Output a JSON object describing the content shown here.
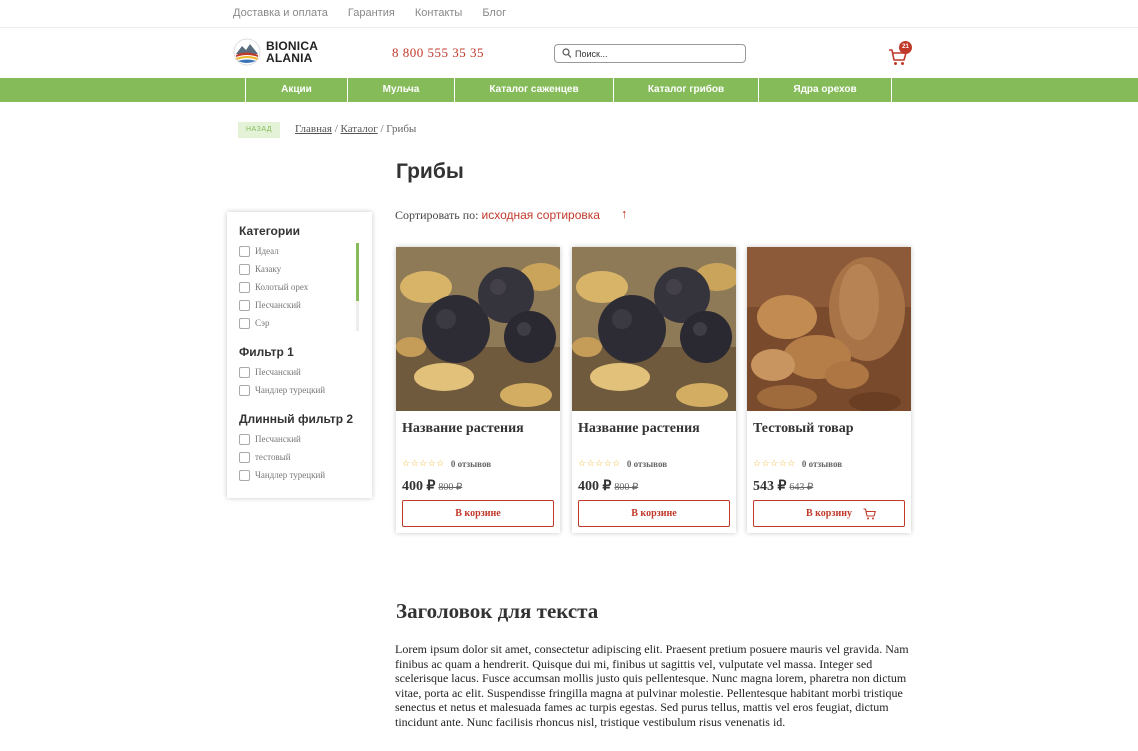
{
  "topbar": {
    "links": [
      "Доставка и оплата",
      "Гарантия",
      "Контакты",
      "Блог"
    ]
  },
  "header": {
    "logo_line1": "BIONICA",
    "logo_line2": "ALANIA",
    "phone": "8 800 555 35 35",
    "search_placeholder": "Поиск...",
    "cart_count": "21"
  },
  "nav": {
    "items": [
      "Акции",
      "Мульча",
      "Каталог саженцев",
      "Каталог грибов",
      "Ядра орехов"
    ]
  },
  "breadcrumb": {
    "back": "НАЗАД",
    "home": "Главная",
    "catalog": "Каталог",
    "current": "Грибы",
    "sep": " / "
  },
  "page": {
    "title": "Грибы",
    "sort_label": "Сортировать по: ",
    "sort_value": "исходная сортировка",
    "sort_arrow": "↑"
  },
  "sidebar": {
    "groups": [
      {
        "title": "Категории",
        "options": [
          "Идеал",
          "Казаку",
          "Колотый орех",
          "Песчанский",
          "Сэр"
        ]
      },
      {
        "title": "Фильтр 1",
        "options": [
          "Песчанский",
          "Чандлер турецкий"
        ]
      },
      {
        "title": "Длинный фильтр 2",
        "options": [
          "Песчанский",
          "тестовый",
          "Чандлер турецкий"
        ]
      }
    ]
  },
  "products": [
    {
      "name": "Название растения",
      "stars": "☆☆☆☆☆",
      "reviews": "0 отзывов",
      "price": "400 ₽",
      "old_price": "800 ₽",
      "button": "В корзине",
      "image": "truffles"
    },
    {
      "name": "Название растения",
      "stars": "☆☆☆☆☆",
      "reviews": "0 отзывов",
      "price": "400 ₽",
      "old_price": "800 ₽",
      "button": "В корзине",
      "image": "truffles"
    },
    {
      "name": "Тестовый товар",
      "stars": "☆☆☆☆☆",
      "reviews": "0 отзывов",
      "price": "543 ₽",
      "old_price": "643 ₽",
      "button": "В корзину",
      "image": "walnuts"
    }
  ],
  "text_section": {
    "title": "Заголовок для текста",
    "body": "Lorem ipsum dolor sit amet, consectetur adipiscing elit. Praesent pretium posuere mauris vel gravida. Nam finibus ac quam a hendrerit. Quisque dui mi, finibus ut sagittis vel, vulputate vel massa. Integer sed scelerisque lacus. Fusce accumsan mollis justo quis pellentesque. Nunc magna lorem, pharetra non dictum vitae, porta ac elit. Suspendisse fringilla magna at pulvinar molestie. Pellentesque habitant morbi tristique senectus et netus et malesuada fames ac turpis egestas. Sed purus tellus, mattis vel eros feugiat, dictum tincidunt ante. Nunc facilisis rhoncus nisl, tristique vestibulum risus venenatis id."
  },
  "colors": {
    "accent_green": "#86bb5a",
    "accent_red": "#c0392b"
  }
}
